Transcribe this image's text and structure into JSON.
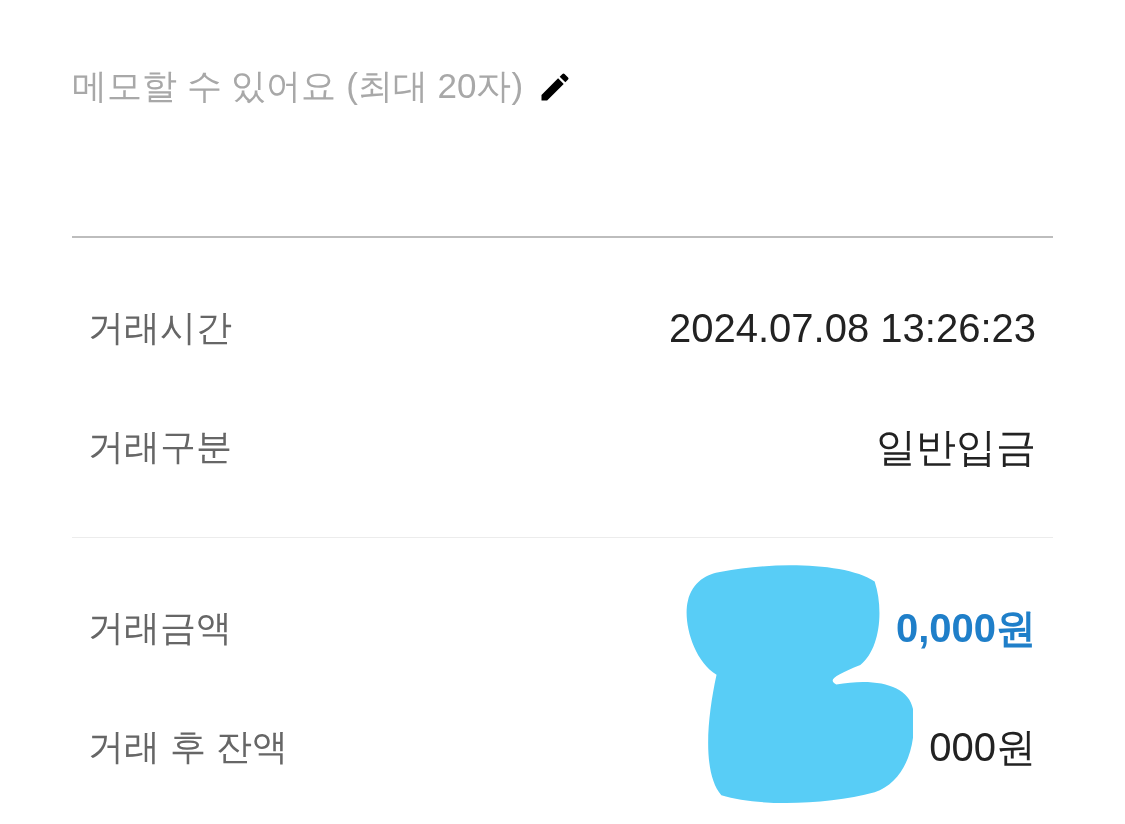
{
  "memo": {
    "placeholder": "메모할 수 있어요 (최대 20자)"
  },
  "detail_groups": [
    {
      "rows": [
        {
          "label": "거래시간",
          "value": "2024.07.08 13:26:23",
          "kind": "plain"
        },
        {
          "label": "거래구분",
          "value": "일반입금",
          "kind": "plain"
        }
      ]
    },
    {
      "rows": [
        {
          "label": "거래금액",
          "value": "0,000원",
          "kind": "amount"
        },
        {
          "label": "거래 후 잔액",
          "value": "000원",
          "kind": "plain"
        }
      ]
    }
  ]
}
